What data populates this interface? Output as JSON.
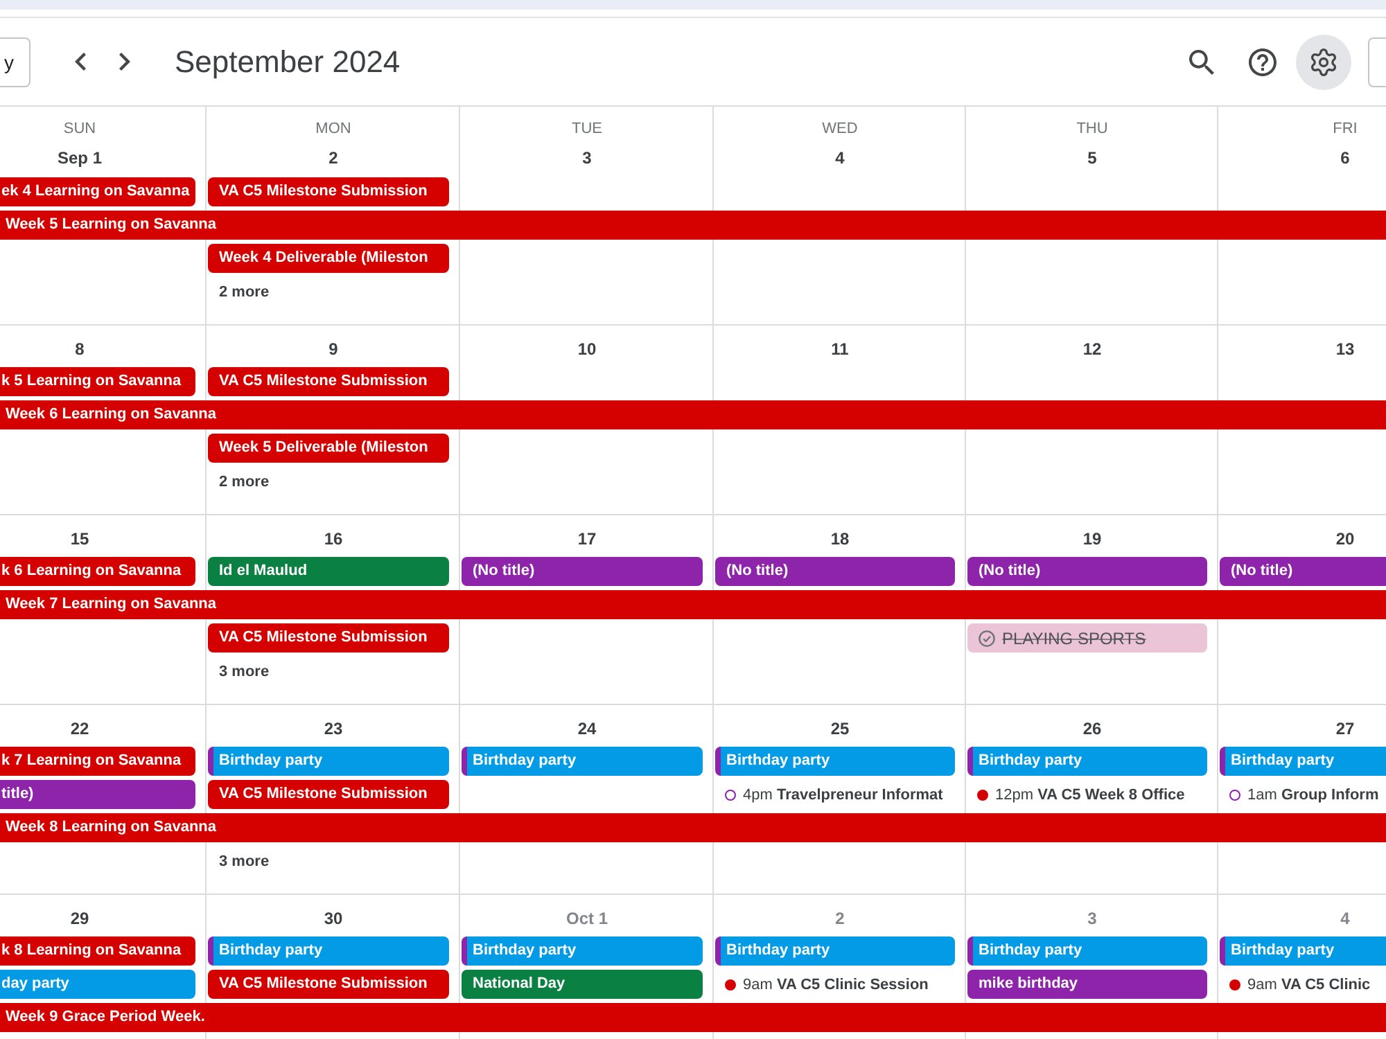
{
  "header": {
    "left_button": {
      "label": "y"
    },
    "title": "September 2024",
    "icon_buttons": [
      {
        "kind": "search",
        "selected": false
      },
      {
        "kind": "help",
        "selected": false
      },
      {
        "kind": "settings",
        "selected": true
      }
    ]
  },
  "weeks": [
    {
      "days": [
        {
          "weekday": "SUN",
          "date": "Sep 1",
          "outside_month": false
        },
        {
          "weekday": "MON",
          "date": "2",
          "outside_month": false
        },
        {
          "weekday": "TUE",
          "date": "3",
          "outside_month": false
        },
        {
          "weekday": "WED",
          "date": "4",
          "outside_month": false
        },
        {
          "weekday": "THU",
          "date": "5",
          "outside_month": false
        },
        {
          "weekday": "FRI",
          "date": "6",
          "outside_month": false
        }
      ],
      "lanes": [
        {
          "kind": "days",
          "cells": [
            {
              "kind": "chip",
              "title": "ek 4 Learning on Savanna",
              "color": "#d50000"
            },
            {
              "kind": "chip",
              "title": "VA C5 Milestone Submission",
              "color": "#d50000"
            }
          ]
        },
        {
          "kind": "bar",
          "title": "Week 5 Learning on Savanna",
          "color": "#d50000"
        },
        {
          "kind": "days",
          "cells": [
            {
              "kind": "empty"
            },
            {
              "kind": "chip",
              "title": "Week 4 Deliverable (Mileston",
              "color": "#d50000"
            }
          ]
        },
        {
          "kind": "days",
          "cells": [
            {
              "kind": "empty"
            },
            {
              "kind": "more",
              "label": "2 more"
            }
          ]
        }
      ]
    },
    {
      "days": [
        {
          "date": "8",
          "outside_month": false
        },
        {
          "date": "9",
          "outside_month": false
        },
        {
          "date": "10",
          "outside_month": false
        },
        {
          "date": "11",
          "outside_month": false
        },
        {
          "date": "12",
          "outside_month": false
        },
        {
          "date": "13",
          "outside_month": false
        }
      ],
      "lanes": [
        {
          "kind": "days",
          "cells": [
            {
              "kind": "chip",
              "title": "k 5 Learning on Savanna",
              "color": "#d50000"
            },
            {
              "kind": "chip",
              "title": "VA C5 Milestone Submission",
              "color": "#d50000"
            }
          ]
        },
        {
          "kind": "bar",
          "title": "Week 6 Learning on Savanna",
          "color": "#d50000"
        },
        {
          "kind": "days",
          "cells": [
            {
              "kind": "empty"
            },
            {
              "kind": "chip",
              "title": "Week 5 Deliverable (Mileston",
              "color": "#d50000"
            }
          ]
        },
        {
          "kind": "days",
          "cells": [
            {
              "kind": "empty"
            },
            {
              "kind": "more",
              "label": "2 more"
            }
          ]
        }
      ]
    },
    {
      "days": [
        {
          "date": "15",
          "outside_month": false
        },
        {
          "date": "16",
          "outside_month": false
        },
        {
          "date": "17",
          "outside_month": false
        },
        {
          "date": "18",
          "outside_month": false
        },
        {
          "date": "19",
          "outside_month": false
        },
        {
          "date": "20",
          "outside_month": false
        }
      ],
      "lanes": [
        {
          "kind": "days",
          "cells": [
            {
              "kind": "chip",
              "title": "k 6 Learning on Savanna",
              "color": "#d50000"
            },
            {
              "kind": "chip",
              "title": "Id el Maulud",
              "color": "#0b8043"
            },
            {
              "kind": "chip",
              "title": "(No title)",
              "color": "#8e24aa"
            },
            {
              "kind": "chip",
              "title": "(No title)",
              "color": "#8e24aa"
            },
            {
              "kind": "chip",
              "title": "(No title)",
              "color": "#8e24aa"
            },
            {
              "kind": "chip",
              "title": "(No title)",
              "color": "#8e24aa"
            }
          ]
        },
        {
          "kind": "bar",
          "title": "Week 7 Learning on Savanna",
          "color": "#d50000"
        },
        {
          "kind": "days",
          "cells": [
            {
              "kind": "empty"
            },
            {
              "kind": "chip",
              "title": "VA C5 Milestone Submission",
              "color": "#d50000"
            },
            {
              "kind": "empty"
            },
            {
              "kind": "empty"
            },
            {
              "kind": "task",
              "title": "PLAYING SPORTS",
              "color": "#ecc4d8",
              "done": true
            }
          ]
        },
        {
          "kind": "days",
          "cells": [
            {
              "kind": "empty"
            },
            {
              "kind": "more",
              "label": "3 more"
            }
          ]
        }
      ]
    },
    {
      "days": [
        {
          "date": "22",
          "outside_month": false
        },
        {
          "date": "23",
          "outside_month": false
        },
        {
          "date": "24",
          "outside_month": false
        },
        {
          "date": "25",
          "outside_month": false
        },
        {
          "date": "26",
          "outside_month": false
        },
        {
          "date": "27",
          "outside_month": false
        }
      ],
      "lanes": [
        {
          "kind": "days",
          "cells": [
            {
              "kind": "chip",
              "title": "k 7 Learning on Savanna",
              "color": "#d50000"
            },
            {
              "kind": "chip",
              "title": "Birthday party",
              "color": "#039be5",
              "stripe": {
                "color": "#8e24aa"
              }
            },
            {
              "kind": "chip",
              "title": "Birthday party",
              "color": "#039be5",
              "stripe": {
                "color": "#8e24aa"
              }
            },
            {
              "kind": "chip",
              "title": "Birthday party",
              "color": "#039be5",
              "stripe": {
                "color": "#8e24aa"
              }
            },
            {
              "kind": "chip",
              "title": "Birthday party",
              "color": "#039be5",
              "stripe": {
                "color": "#8e24aa"
              }
            },
            {
              "kind": "chip",
              "title": "Birthday party",
              "color": "#039be5",
              "stripe": {
                "color": "#8e24aa"
              }
            }
          ]
        },
        {
          "kind": "days",
          "cells": [
            {
              "kind": "chip",
              "title": "title)",
              "color": "#8e24aa"
            },
            {
              "kind": "chip",
              "title": "VA C5 Milestone Submission",
              "color": "#d50000"
            },
            {
              "kind": "empty"
            },
            {
              "kind": "timed",
              "time": "4pm",
              "title": "Travelpreneur Informat",
              "color": "#8e24aa",
              "filled": false
            },
            {
              "kind": "timed",
              "time": "12pm",
              "title": "VA C5 Week 8 Office",
              "color": "#d50000",
              "filled": true
            },
            {
              "kind": "timed",
              "time": "1am",
              "title": "Group Inform",
              "color": "#8e24aa",
              "filled": false
            }
          ]
        },
        {
          "kind": "bar",
          "title": "Week 8 Learning on Savanna",
          "color": "#d50000"
        },
        {
          "kind": "days",
          "cells": [
            {
              "kind": "empty"
            },
            {
              "kind": "more",
              "label": "3 more"
            }
          ]
        }
      ]
    },
    {
      "days": [
        {
          "date": "29",
          "outside_month": false
        },
        {
          "date": "30",
          "outside_month": false
        },
        {
          "date": "Oct 1",
          "outside_month": true
        },
        {
          "date": "2",
          "outside_month": true
        },
        {
          "date": "3",
          "outside_month": true
        },
        {
          "date": "4",
          "outside_month": true
        }
      ],
      "lanes": [
        {
          "kind": "days",
          "cells": [
            {
              "kind": "chip",
              "title": "k 8 Learning on Savanna",
              "color": "#d50000"
            },
            {
              "kind": "chip",
              "title": "Birthday party",
              "color": "#039be5",
              "stripe": {
                "color": "#8e24aa"
              }
            },
            {
              "kind": "chip",
              "title": "Birthday party",
              "color": "#039be5",
              "stripe": {
                "color": "#8e24aa"
              }
            },
            {
              "kind": "chip",
              "title": "Birthday party",
              "color": "#039be5",
              "stripe": {
                "color": "#8e24aa"
              }
            },
            {
              "kind": "chip",
              "title": "Birthday party",
              "color": "#039be5",
              "stripe": {
                "color": "#8e24aa"
              }
            },
            {
              "kind": "chip",
              "title": "Birthday party",
              "color": "#039be5",
              "stripe": {
                "color": "#8e24aa"
              }
            }
          ]
        },
        {
          "kind": "days",
          "cells": [
            {
              "kind": "chip",
              "title": "day party",
              "color": "#039be5"
            },
            {
              "kind": "chip",
              "title": "VA C5 Milestone Submission",
              "color": "#d50000"
            },
            {
              "kind": "chip",
              "title": "National Day",
              "color": "#0b8043"
            },
            {
              "kind": "timed",
              "time": "9am",
              "title": "VA C5 Clinic Session",
              "color": "#d50000",
              "filled": true
            },
            {
              "kind": "chip",
              "title": "mike birthday",
              "color": "#8e24aa"
            },
            {
              "kind": "timed",
              "time": "9am",
              "title": "VA C5 Clinic",
              "color": "#d50000",
              "filled": true
            }
          ]
        },
        {
          "kind": "bar",
          "title": "Week 9 Grace Period Week.",
          "color": "#d50000"
        }
      ]
    }
  ]
}
